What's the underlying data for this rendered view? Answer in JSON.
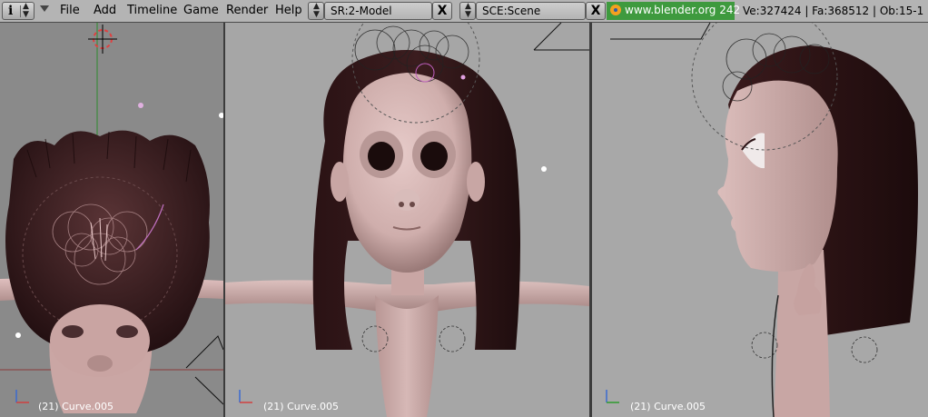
{
  "header": {
    "window_type_glyph": "i",
    "menus": [
      "File",
      "Add",
      "Timeline",
      "Game",
      "Render",
      "Help"
    ],
    "screen_field": "SR:2-Model",
    "scene_field": "SCE:Scene",
    "close_glyph": "X",
    "url": "www.blender.org 242",
    "stats": "Ve:327424 | Fa:368512 | Ob:15-1 |"
  },
  "viewports": {
    "left": {
      "object_label": "(21) Curve.005",
      "axes": [
        "z",
        "x"
      ]
    },
    "middle": {
      "object_label": "(21) Curve.005",
      "axes": [
        "z",
        "x"
      ]
    },
    "right": {
      "object_label": "(21) Curve.005",
      "axes": [
        "z",
        "y"
      ]
    }
  },
  "colors": {
    "header_bg": "#b4b4b4",
    "url_bg": "#3e9a3e",
    "skin": "#d8b4b2",
    "hair": "#2a1416",
    "viewport_bg": "#a6a6a6"
  },
  "icons": [
    "window-type-info-icon",
    "collapse-triangle-icon",
    "browse-arrows-icon",
    "close-x-icon",
    "blender-logo-icon",
    "3d-cursor-icon",
    "axis-gizmo-icon"
  ]
}
